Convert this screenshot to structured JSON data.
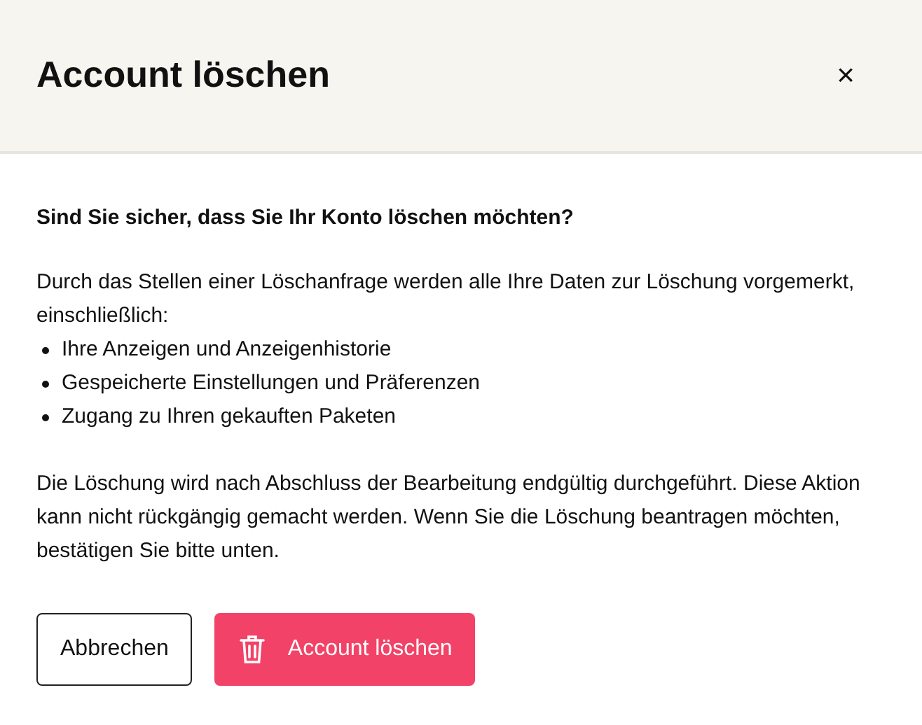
{
  "dialog": {
    "title": "Account löschen",
    "close": "×",
    "question": "Sind Sie sicher, dass Sie Ihr Konto löschen möchten?",
    "intro": "Durch das Stellen einer Löschanfrage werden alle Ihre Daten zur Löschung vorgemerkt, einschließlich:",
    "items": [
      "Ihre Anzeigen und Anzeigenhistorie",
      "Gespeicherte Einstellungen und Präferenzen",
      "Zugang zu Ihren gekauften Paketen"
    ],
    "note": "Die Löschung wird nach Abschluss der Bearbeitung endgültig durchgeführt. Diese Aktion kann nicht rückgängig gemacht werden. Wenn Sie die Löschung beantragen möchten, bestätigen Sie bitte unten.",
    "buttons": [
      {
        "kind": "secondary",
        "label": "Abbrechen"
      },
      {
        "kind": "danger",
        "label": "Account löschen"
      }
    ]
  }
}
